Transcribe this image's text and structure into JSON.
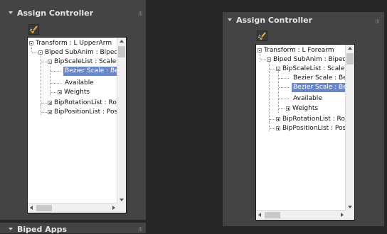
{
  "left_panel": {
    "title": "Assign Controller",
    "tree": [
      {
        "label": "Transform : L UpperArm"
      },
      {
        "label": "Biped SubAnim : Biped"
      },
      {
        "label": "BipScaleList : Scale"
      },
      {
        "label": "Bezier Scale : Be"
      },
      {
        "label": "Available"
      },
      {
        "label": "Weights"
      },
      {
        "label": "BipRotationList : Ro"
      },
      {
        "label": "BipPositionList : Pos"
      }
    ]
  },
  "right_panel": {
    "title": "Assign Controller",
    "tree": [
      {
        "label": "Transform : L Forearm"
      },
      {
        "label": "Biped SubAnim : Biped"
      },
      {
        "label": "BipScaleList : Scale"
      },
      {
        "label": "Bezier Scale : Be"
      },
      {
        "label": "Bezier Scale : Be"
      },
      {
        "label": "Available"
      },
      {
        "label": "Weights"
      },
      {
        "label": "BipRotationList : Ro"
      },
      {
        "label": "BipPositionList : Pos"
      }
    ]
  },
  "bottom_panel": {
    "title": "Biped Apps"
  },
  "colors": {
    "selection": "#6a88c9",
    "panel_bg": "#444444",
    "app_bg": "#262626"
  }
}
